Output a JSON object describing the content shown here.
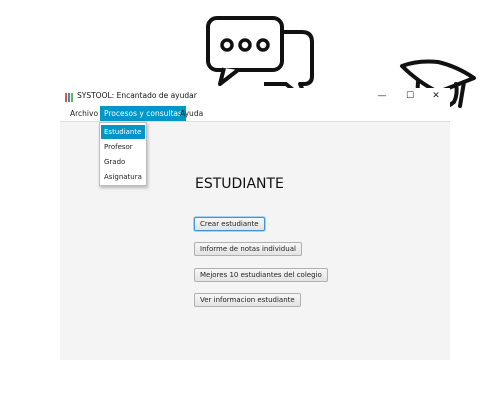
{
  "window": {
    "title": "SYSTOOL: Encantado de ayudar",
    "controls": {
      "minimize": "—",
      "maximize": "☐",
      "close": "✕"
    },
    "icon": "app-icon",
    "icon_colors": [
      "#d9534f",
      "#3c8dbc",
      "#5cb85c"
    ]
  },
  "menubar": {
    "items": [
      {
        "label": "Archivo"
      },
      {
        "label": "Procesos y consultas",
        "active": true
      },
      {
        "label": "Ayuda"
      }
    ]
  },
  "dropdown": {
    "items": [
      {
        "label": "Estudiante",
        "selected": true
      },
      {
        "label": "Profesor"
      },
      {
        "label": "Grado"
      },
      {
        "label": "Asignatura"
      }
    ]
  },
  "main": {
    "heading": "ESTUDIANTE",
    "buttons": [
      {
        "label": "Crear estudiante",
        "focused": true
      },
      {
        "label": "Informe de notas individual"
      },
      {
        "label": "Mejores 10 estudiantes del colegio"
      },
      {
        "label": "Ver informacion estudiante"
      }
    ]
  },
  "decorations": {
    "chat_icon": "chat-bubbles-icon",
    "cap_icon": "graduation-cap-icon"
  },
  "colors": {
    "accent": "#0096c9",
    "window_bg": "#f4f4f4"
  }
}
